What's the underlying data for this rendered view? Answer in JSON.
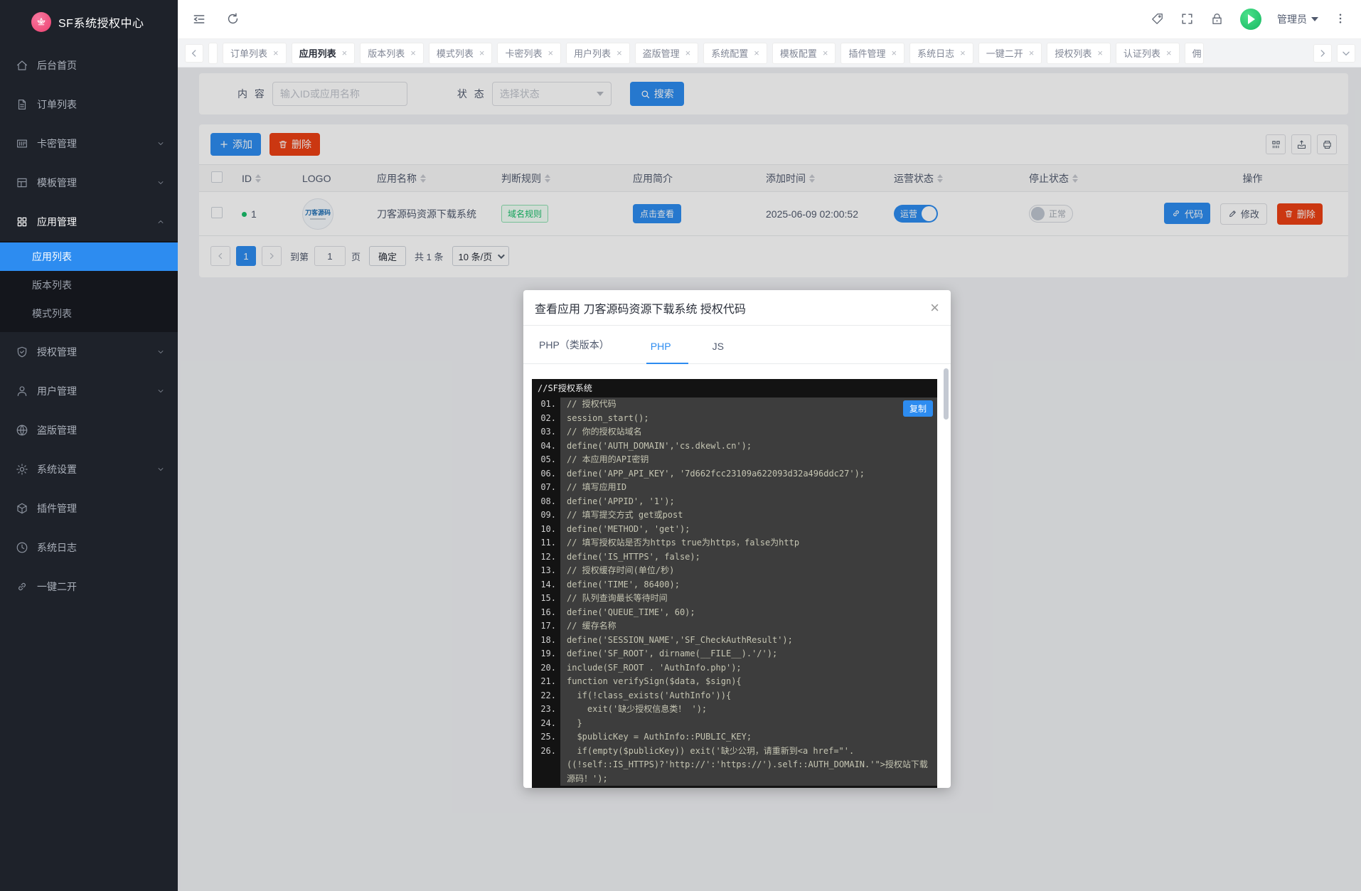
{
  "app": {
    "title": "SF系统授权中心",
    "admin_label": "管理员",
    "accent_color": "#2d8cf0",
    "danger_color": "#ed4014",
    "success_color": "#19be6b"
  },
  "sidebar": {
    "items": [
      {
        "label": "后台首页",
        "icon": "home-icon"
      },
      {
        "label": "订单列表",
        "icon": "file-icon"
      },
      {
        "label": "卡密管理",
        "icon": "card-icon",
        "expandable": true
      },
      {
        "label": "模板管理",
        "icon": "template-icon",
        "expandable": true
      },
      {
        "label": "应用管理",
        "icon": "apps-icon",
        "expandable": true,
        "expanded": true,
        "active": true,
        "children": [
          {
            "label": "应用列表",
            "active": true
          },
          {
            "label": "版本列表"
          },
          {
            "label": "模式列表"
          }
        ]
      },
      {
        "label": "授权管理",
        "icon": "shield-icon",
        "expandable": true
      },
      {
        "label": "用户管理",
        "icon": "user-icon",
        "expandable": true
      },
      {
        "label": "盗版管理",
        "icon": "globe-icon"
      },
      {
        "label": "系统设置",
        "icon": "gear-icon",
        "expandable": true
      },
      {
        "label": "插件管理",
        "icon": "cube-icon"
      },
      {
        "label": "系统日志",
        "icon": "clock-icon"
      },
      {
        "label": "一键二开",
        "icon": "link-icon"
      }
    ]
  },
  "tabs": [
    {
      "label": "",
      "clipped": "start"
    },
    {
      "label": "订单列表"
    },
    {
      "label": "应用列表",
      "active": true
    },
    {
      "label": "版本列表"
    },
    {
      "label": "模式列表"
    },
    {
      "label": "卡密列表"
    },
    {
      "label": "用户列表"
    },
    {
      "label": "盗版管理"
    },
    {
      "label": "系统配置"
    },
    {
      "label": "模板配置"
    },
    {
      "label": "插件管理"
    },
    {
      "label": "系统日志"
    },
    {
      "label": "一键二开"
    },
    {
      "label": "授权列表"
    },
    {
      "label": "认证列表"
    },
    {
      "label": "佣",
      "clipped": "end"
    }
  ],
  "filter": {
    "content_label": "内 容",
    "content_placeholder": "输入ID或应用名称",
    "status_label": "状 态",
    "status_placeholder": "选择状态",
    "search_label": "搜索"
  },
  "toolbar": {
    "add_label": "添加",
    "delete_label": "删除"
  },
  "table": {
    "headers": [
      {
        "label": "ID",
        "sortable": true
      },
      {
        "label": "LOGO"
      },
      {
        "label": "应用名称",
        "sortable": true
      },
      {
        "label": "判断规则",
        "sortable": true
      },
      {
        "label": "应用简介"
      },
      {
        "label": "添加时间",
        "sortable": true
      },
      {
        "label": "运营状态",
        "sortable": true
      },
      {
        "label": "停止状态",
        "sortable": true
      },
      {
        "label": "操作"
      }
    ],
    "row": {
      "id": "1",
      "logo_text": "刀客源码",
      "name": "刀客源码资源下载系统",
      "rule_tag": "域名规则",
      "intro_button": "点击查看",
      "added_at": "2025-06-09 02:00:52",
      "run_status": "运营",
      "stop_status": "正常",
      "actions": {
        "code": "代码",
        "edit": "修改",
        "delete": "删除"
      }
    }
  },
  "pagination": {
    "page": "1",
    "goto_label": "到第",
    "goto_value": "1",
    "page_unit": "页",
    "confirm_label": "确定",
    "total_label": "共 1 条",
    "per_page_label": "10 条/页"
  },
  "modal": {
    "title": "查看应用 刀客源码资源下载系统 授权代码",
    "close": "×",
    "tabs": [
      {
        "label": "PHP（类版本）"
      },
      {
        "label": "PHP",
        "active": true
      },
      {
        "label": "JS"
      }
    ],
    "code_header": "//SF授权系统",
    "copy_label": "复制",
    "lines": [
      {
        "n": "01.",
        "t": "// 授权代码"
      },
      {
        "n": "02.",
        "t": "session_start();"
      },
      {
        "n": "03.",
        "t": "// 你的授权站域名"
      },
      {
        "n": "04.",
        "t": "define('AUTH_DOMAIN','cs.dkewl.cn');"
      },
      {
        "n": "05.",
        "t": "// 本应用的API密钥"
      },
      {
        "n": "06.",
        "t": "define('APP_API_KEY', '7d662fcc23109a622093d32a496ddc27');"
      },
      {
        "n": "07.",
        "t": "// 填写应用ID"
      },
      {
        "n": "08.",
        "t": "define('APPID', '1');"
      },
      {
        "n": "09.",
        "t": "// 填写提交方式 get或post"
      },
      {
        "n": "10.",
        "t": "define('METHOD', 'get');"
      },
      {
        "n": "11.",
        "t": "// 填写授权站是否为https true为https，false为http"
      },
      {
        "n": "12.",
        "t": "define('IS_HTTPS', false);"
      },
      {
        "n": "13.",
        "t": "// 授权缓存时间(单位/秒)"
      },
      {
        "n": "14.",
        "t": "define('TIME', 86400);"
      },
      {
        "n": "15.",
        "t": "// 队列查询最长等待时间"
      },
      {
        "n": "16.",
        "t": "define('QUEUE_TIME', 60);"
      },
      {
        "n": "17.",
        "t": "// 缓存名称"
      },
      {
        "n": "18.",
        "t": "define('SESSION_NAME','SF_CheckAuthResult');"
      },
      {
        "n": "19.",
        "t": "define('SF_ROOT', dirname(__FILE__).'/');"
      },
      {
        "n": "20.",
        "t": "include(SF_ROOT . 'AuthInfo.php');"
      },
      {
        "n": "21.",
        "t": "function verifySign($data, $sign){"
      },
      {
        "n": "22.",
        "t": "  if(!class_exists('AuthInfo')){"
      },
      {
        "n": "23.",
        "t": "    exit('缺少授权信息类！ ');"
      },
      {
        "n": "24.",
        "t": "  }"
      },
      {
        "n": "25.",
        "t": "  $publicKey = AuthInfo::PUBLIC_KEY;"
      },
      {
        "n": "26.",
        "t": "  if(empty($publicKey)) exit('缺少公玥，请重新到<a href=\"'.\n((!self::IS_HTTPS)?'http://':'https://').self::AUTH_DOMAIN.'\">授权站下载源码！');"
      }
    ]
  }
}
